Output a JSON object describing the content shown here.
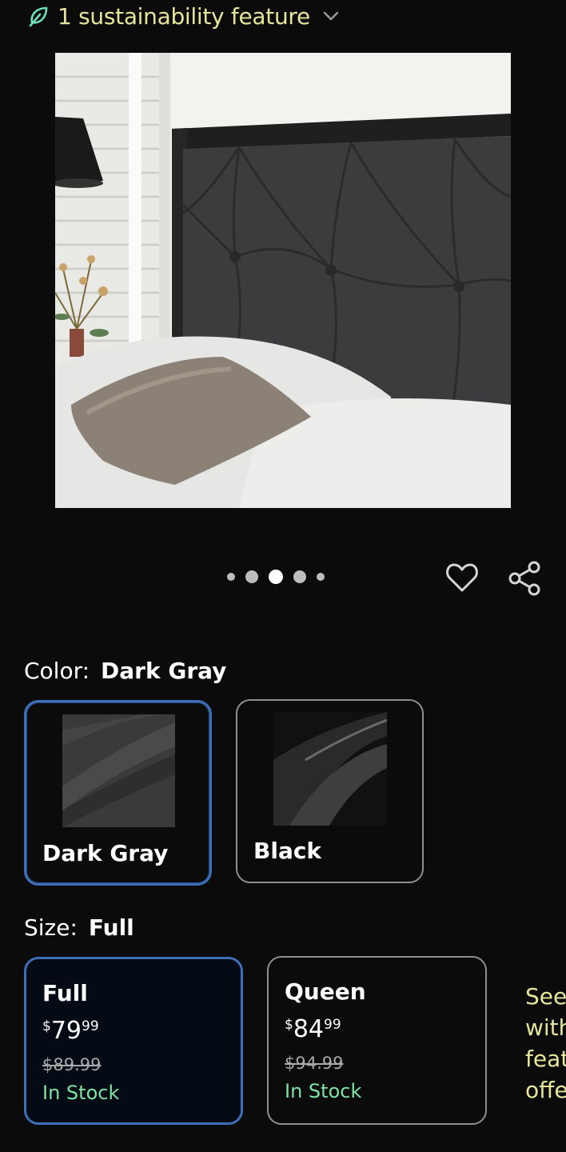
{
  "sustainability": {
    "label": "1 sustainability feature"
  },
  "carousel": {
    "count": 5,
    "active_index": 2
  },
  "color": {
    "label": "Color:",
    "selected": "Dark Gray",
    "options": [
      {
        "name": "Dark Gray",
        "selected": true
      },
      {
        "name": "Black",
        "selected": false
      }
    ]
  },
  "size": {
    "label": "Size:",
    "selected": "Full",
    "options": [
      {
        "name": "Full",
        "currency": "$",
        "price_whole": "79",
        "price_cents": "99",
        "was_price": "$89.99",
        "stock": "In Stock",
        "selected": true
      },
      {
        "name": "Queen",
        "currency": "$",
        "price_whole": "84",
        "price_cents": "99",
        "was_price": "$94.99",
        "stock": "In Stock",
        "selected": false
      }
    ]
  },
  "side_note": {
    "lines": [
      "See",
      "with",
      "feat",
      "offe"
    ]
  },
  "colors": {
    "accent_select": "#3d6fb8",
    "sustain_text": "#e6e59a",
    "stock_text": "#7de3a4"
  }
}
